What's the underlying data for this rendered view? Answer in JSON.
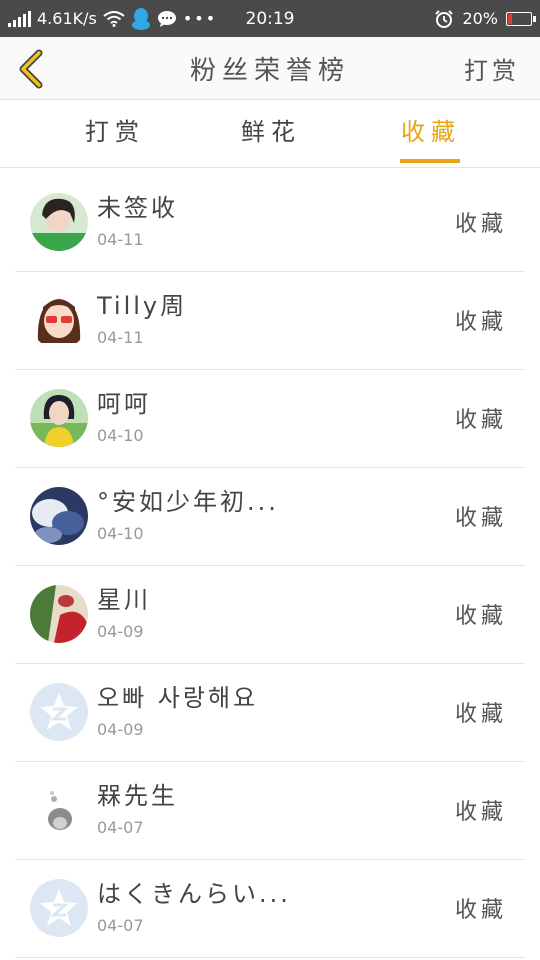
{
  "status_bar": {
    "speed": "4.61K/s",
    "clock": "20:19",
    "battery": "20%",
    "battery_level": 0.2
  },
  "header": {
    "title": "粉丝荣誉榜",
    "action_label": "打赏"
  },
  "tabs": [
    {
      "label": "打赏",
      "active": false
    },
    {
      "label": "鲜花",
      "active": false
    },
    {
      "label": "收藏",
      "active": true
    }
  ],
  "list": [
    {
      "name": "未签收",
      "date": "04-11",
      "action": "收藏",
      "avatar": "photo-girl"
    },
    {
      "name": "Tilly周",
      "date": "04-11",
      "action": "收藏",
      "avatar": "cartoon-girl-glasses"
    },
    {
      "name": "呵呵",
      "date": "04-10",
      "action": "收藏",
      "avatar": "photo-girl-yellow"
    },
    {
      "name": "°安如少年初...",
      "date": "04-10",
      "action": "收藏",
      "avatar": "photo-dark-blue"
    },
    {
      "name": "星川",
      "date": "04-09",
      "action": "收藏",
      "avatar": "photo-red"
    },
    {
      "name": "오빠 사랑해요",
      "date": "04-09",
      "action": "收藏",
      "avatar": "default-qzone-star"
    },
    {
      "name": "槑先生",
      "date": "04-07",
      "action": "收藏",
      "avatar": "cartoon-animal"
    },
    {
      "name": "はくきんらい...",
      "date": "04-07",
      "action": "收藏",
      "avatar": "default-qzone-star"
    }
  ]
}
